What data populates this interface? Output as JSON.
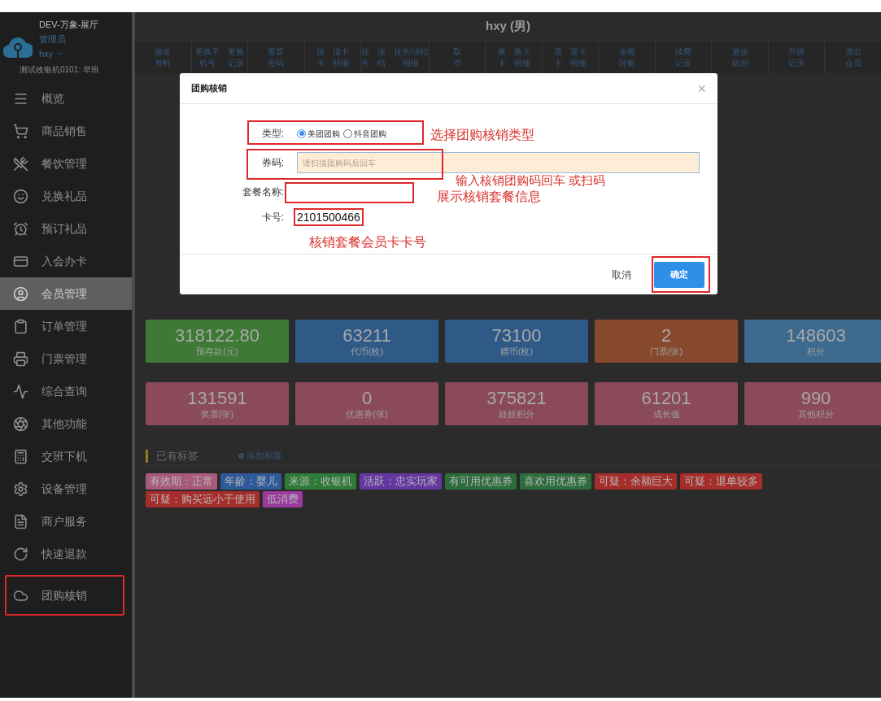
{
  "app": {
    "venue": "DEV-万象-展厅",
    "role": "管理员",
    "user": "hxy",
    "terminal": "测试收银机0101: 早班"
  },
  "sidebar": {
    "items": [
      {
        "label": "概览",
        "kind": "menu",
        "selected": false,
        "annotated": false
      },
      {
        "label": "商品销售",
        "kind": "cart",
        "selected": false,
        "annotated": false
      },
      {
        "label": "餐饮管理",
        "kind": "dining",
        "selected": false,
        "annotated": false
      },
      {
        "label": "兑换礼品",
        "kind": "gift",
        "selected": false,
        "annotated": false
      },
      {
        "label": "预订礼品",
        "kind": "alarm",
        "selected": false,
        "annotated": false
      },
      {
        "label": "入会办卡",
        "kind": "card",
        "selected": false,
        "annotated": false
      },
      {
        "label": "会员管理",
        "kind": "user",
        "selected": true,
        "annotated": false
      },
      {
        "label": "订单管理",
        "kind": "clipboard",
        "selected": false,
        "annotated": false
      },
      {
        "label": "门票管理",
        "kind": "printer",
        "selected": false,
        "annotated": false
      },
      {
        "label": "综合查询",
        "kind": "pulse",
        "selected": false,
        "annotated": false
      },
      {
        "label": "其他功能",
        "kind": "aperture",
        "selected": false,
        "annotated": false
      },
      {
        "label": "交班下机",
        "kind": "calculator",
        "selected": false,
        "annotated": false
      },
      {
        "label": "设备管理",
        "kind": "gear",
        "selected": false,
        "annotated": false
      },
      {
        "label": "商户服务",
        "kind": "document",
        "selected": false,
        "annotated": false
      },
      {
        "label": "快速退款",
        "kind": "refresh",
        "selected": false,
        "annotated": false
      },
      {
        "label": "团购核销",
        "kind": "cloud",
        "selected": false,
        "annotated": true
      }
    ]
  },
  "member": {
    "title": "hxy (男)"
  },
  "toolbar": {
    "groups": [
      [
        {
          "lines": [
            "修改",
            "资料"
          ]
        }
      ],
      [
        {
          "lines": [
            "更换手",
            "机号"
          ]
        },
        {
          "lines": [
            "更换",
            "记录"
          ]
        }
      ],
      [
        {
          "lines": [
            "重置",
            "密码"
          ]
        }
      ],
      [
        {
          "lines": [
            "借",
            "卡"
          ]
        },
        {
          "lines": [
            "借卡",
            "明细"
          ]
        }
      ],
      [
        {
          "lines": [
            "挂",
            "失"
          ]
        },
        {
          "lines": [
            "冻",
            "结"
          ]
        },
        {
          "lines": [
            "挂失/冻结",
            "明细"
          ]
        }
      ],
      [
        {
          "lines": [
            "取",
            "币"
          ]
        }
      ],
      [
        {
          "lines": [
            "换",
            "卡"
          ]
        },
        {
          "lines": [
            "换卡",
            "明细"
          ]
        }
      ],
      [
        {
          "lines": [
            "退",
            "卡"
          ]
        },
        {
          "lines": [
            "退卡",
            "明细"
          ]
        }
      ],
      [
        {
          "lines": [
            "余额",
            "转账"
          ]
        }
      ],
      [
        {
          "lines": [
            "续费",
            "记录"
          ]
        }
      ],
      [
        {
          "lines": [
            "更改",
            "级别"
          ]
        }
      ],
      [
        {
          "lines": [
            "升级",
            "记录"
          ]
        }
      ],
      [
        {
          "lines": [
            "退出",
            "会员"
          ]
        }
      ]
    ]
  },
  "stats": [
    [
      {
        "value": "318122.80",
        "label": "预存款(元)",
        "color": "#3e7a35"
      },
      {
        "value": "63211",
        "label": "代币(枚)",
        "color": "#2f5a88"
      },
      {
        "value": "73100",
        "label": "赠币(枚)",
        "color": "#2f5a88"
      },
      {
        "value": "2",
        "label": "门票(张)",
        "color": "#87492d"
      },
      {
        "value": "148603",
        "label": "积分",
        "color": "#3d6a8e"
      }
    ],
    [
      {
        "value": "131591",
        "label": "奖票(张)",
        "color": "#8a4a5a"
      },
      {
        "value": "0",
        "label": "优惠券(张)",
        "color": "#8a4a5a"
      },
      {
        "value": "375821",
        "label": "娃娃积分",
        "color": "#8a4a5a"
      },
      {
        "value": "61201",
        "label": "成长值",
        "color": "#8a4a5a"
      },
      {
        "value": "990",
        "label": "其他积分",
        "color": "#8a4a5a"
      }
    ]
  ],
  "tags_section": {
    "title": "已有标签",
    "add_link": "添加标签",
    "tags": [
      {
        "text": "有效期：正常",
        "color": "#a85a7c"
      },
      {
        "text": "年龄：婴儿",
        "color": "#2f5a9a"
      },
      {
        "text": "来源：收银机",
        "color": "#2e7a38"
      },
      {
        "text": "活跃：忠实玩家",
        "color": "#6436a0"
      },
      {
        "text": "有可用优惠券",
        "color": "#2d6c3c"
      },
      {
        "text": "喜欢用优惠券",
        "color": "#2d6c3c"
      },
      {
        "text": "可疑：余额巨大",
        "color": "#a52e2b"
      },
      {
        "text": "可疑：退单较多",
        "color": "#a52e2b"
      },
      {
        "text": "可疑：购买远小于使用",
        "color": "#a52e2b"
      },
      {
        "text": "低消费",
        "color": "#9a3a9e"
      }
    ]
  },
  "dialog": {
    "title": "团购核销",
    "close": "×",
    "type_label": "类型:",
    "options": [
      {
        "label": "美团团购",
        "selected": true
      },
      {
        "label": "抖音团购",
        "selected": false
      }
    ],
    "code_label": "券码:",
    "code_placeholder": "请扫描团购码后回车",
    "package_label": "套餐名称:",
    "card_label": "卡号:",
    "card_value": "2101500466",
    "cancel": "取消",
    "confirm": "确定"
  },
  "annotations": [
    "选择团购核销类型",
    "输入核销团购码回车 或扫码",
    "展示核销套餐信息",
    "核销套餐会员卡卡号"
  ]
}
